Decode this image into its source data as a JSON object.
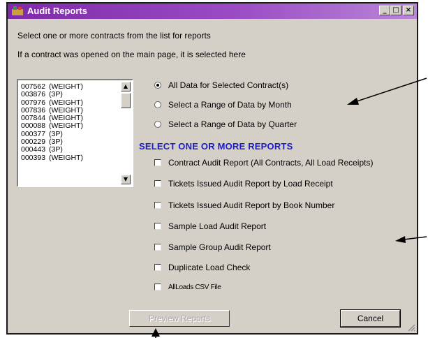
{
  "window": {
    "title": "Audit Reports",
    "minimize_glyph": "_",
    "maximize_glyph": "□",
    "close_glyph": "×"
  },
  "hints": [
    "Select one or more contracts from the list for reports",
    "If a contract was opened on the main page, it is selected here"
  ],
  "contracts": [
    {
      "code": "007562",
      "type": "(WEIGHT)"
    },
    {
      "code": "003876",
      "type": "(3P)"
    },
    {
      "code": "007976",
      "type": "(WEIGHT)"
    },
    {
      "code": "007836",
      "type": "(WEIGHT)"
    },
    {
      "code": "007844",
      "type": "(WEIGHT)"
    },
    {
      "code": "000088",
      "type": "(WEIGHT)"
    },
    {
      "code": "000377",
      "type": "(3P)"
    },
    {
      "code": "000229",
      "type": "(3P)"
    },
    {
      "code": "000443",
      "type": "(3P)"
    },
    {
      "code": "000393",
      "type": "(WEIGHT)"
    }
  ],
  "range_options": [
    {
      "label": "All Data for Selected Contract(s)",
      "selected": true
    },
    {
      "label": "Select a Range of Data by Month",
      "selected": false
    },
    {
      "label": "Select a Range of Data by Quarter",
      "selected": false
    }
  ],
  "reports_heading": "SELECT ONE OR MORE REPORTS",
  "reports": [
    {
      "label": "Contract Audit Report (All Contracts, All Load Receipts)",
      "checked": false
    },
    {
      "label": "Tickets Issued Audit Report by Load Receipt",
      "checked": false
    },
    {
      "label": "Tickets Issued Audit Report by Book Number",
      "checked": false
    },
    {
      "label": "Sample Load Audit Report",
      "checked": false
    },
    {
      "label": "Sample Group Audit Report",
      "checked": false
    },
    {
      "label": "Duplicate Load Check",
      "checked": false
    },
    {
      "label": "AllLoads CSV File",
      "checked": false
    }
  ],
  "buttons": {
    "preview": "Preview Reports",
    "cancel": "Cancel"
  },
  "colors": {
    "titlebar": "#7f2aa8",
    "heading": "#1c1cc8",
    "face": "#d4d0c8"
  }
}
